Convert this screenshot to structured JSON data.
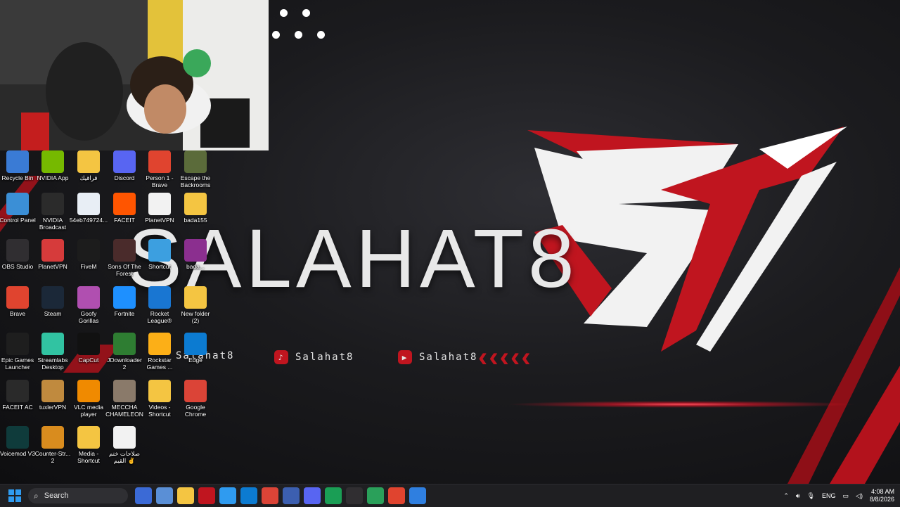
{
  "wallpaper": {
    "name": "SALAHAT8",
    "social_tiktok": "Salahat8",
    "social_youtube": "Salahat8",
    "social_kick": "Salahat8",
    "accent_color": "#c0151f"
  },
  "desktop_icons": [
    {
      "label": "Recycle Bin",
      "icon": "recycle-bin-icon",
      "color": "#3a7bd5"
    },
    {
      "label": "NVIDIA App",
      "icon": "nvidia-icon",
      "color": "#76b900"
    },
    {
      "label": "قراقيك",
      "icon": "folder-icon",
      "color": "#f4c542"
    },
    {
      "label": "Discord",
      "icon": "discord-icon",
      "color": "#5865f2"
    },
    {
      "label": "Person 1 -\nBrave",
      "icon": "brave-icon",
      "color": "#e0442f"
    },
    {
      "label": "Escape the\nBackrooms",
      "icon": "game-icon",
      "color": "#5b6b3a"
    },
    {
      "label": "Control Panel",
      "icon": "control-panel-icon",
      "color": "#3b8fd6"
    },
    {
      "label": "NVIDIA\nBroadcast",
      "icon": "nvidia-broadcast-icon",
      "color": "#2b2b2b"
    },
    {
      "label": "54eb749724...",
      "icon": "file-icon",
      "color": "#e8eef5"
    },
    {
      "label": "FACEIT",
      "icon": "faceit-icon",
      "color": "#ff5500"
    },
    {
      "label": "PlanetVPN",
      "icon": "document-icon",
      "color": "#f2f2f2"
    },
    {
      "label": "bada155",
      "icon": "folder-icon",
      "color": "#f4c542"
    },
    {
      "label": "OBS Studio",
      "icon": "obs-icon",
      "color": "#302e31"
    },
    {
      "label": "PlanetVPN",
      "icon": "planetvpn-icon",
      "color": "#d63b3b"
    },
    {
      "label": "FiveM",
      "icon": "fivem-icon",
      "color": "#1c1c1c"
    },
    {
      "label": "Sons Of The\nForest",
      "icon": "game-icon",
      "color": "#4a2b2b"
    },
    {
      "label": "Shortcut",
      "icon": "shortcut-icon",
      "color": "#3c9fe0"
    },
    {
      "label": "bada...",
      "icon": "winrar-icon",
      "color": "#8b2f8f"
    },
    {
      "label": "Brave",
      "icon": "brave-icon",
      "color": "#e0442f"
    },
    {
      "label": "Steam",
      "icon": "steam-icon",
      "color": "#1b2838"
    },
    {
      "label": "Goofy\nGorillas",
      "icon": "game-icon",
      "color": "#b04fb0"
    },
    {
      "label": "Fortnite",
      "icon": "fortnite-icon",
      "color": "#1e90ff"
    },
    {
      "label": "Rocket\nLeague®",
      "icon": "rocket-league-icon",
      "color": "#1976d2"
    },
    {
      "label": "New folder\n(2)",
      "icon": "folder-icon",
      "color": "#f4c542"
    },
    {
      "label": "Epic Games\nLauncher",
      "icon": "epic-games-icon",
      "color": "#1e1e1e"
    },
    {
      "label": "Streamlabs\nDesktop",
      "icon": "streamlabs-icon",
      "color": "#31c3a2"
    },
    {
      "label": "CapCut",
      "icon": "capcut-icon",
      "color": "#111111"
    },
    {
      "label": "JDownloader\n2",
      "icon": "jdownloader-icon",
      "color": "#2e7d32"
    },
    {
      "label": "Rockstar\nGames ...",
      "icon": "rockstar-icon",
      "color": "#fcaf17"
    },
    {
      "label": "Edge",
      "icon": "edge-icon",
      "color": "#0c7bd1"
    },
    {
      "label": "FACEIT AC",
      "icon": "faceit-ac-icon",
      "color": "#2a2a2a"
    },
    {
      "label": "tuxlerVPN",
      "icon": "tuxler-icon",
      "color": "#c08a3e"
    },
    {
      "label": "VLC media\nplayer",
      "icon": "vlc-icon",
      "color": "#f08a00"
    },
    {
      "label": "MECCHA\nCHAMELEON",
      "icon": "game-icon",
      "color": "#8a7a6a"
    },
    {
      "label": "Videos -\nShortcut",
      "icon": "folder-icon",
      "color": "#f4c542"
    },
    {
      "label": "Google\nChrome",
      "icon": "chrome-icon",
      "color": "#db4437"
    },
    {
      "label": "Voicemod V3",
      "icon": "voicemod-icon",
      "color": "#0f3b3b"
    },
    {
      "label": "Counter-Str...\n2",
      "icon": "cs2-icon",
      "color": "#d98c1e"
    },
    {
      "label": "Media -\nShortcut",
      "icon": "folder-icon",
      "color": "#f4c542"
    },
    {
      "label": "صلاحات ختم\nالقيم ✌",
      "icon": "document-icon",
      "color": "#f2f2f2"
    }
  ],
  "taskbar": {
    "search_placeholder": "Search",
    "apps": [
      {
        "name": "taskview-icon",
        "color": "#3b6ad6"
      },
      {
        "name": "widgets-icon",
        "color": "#5a8fd6"
      },
      {
        "name": "file-explorer-icon",
        "color": "#f4c542"
      },
      {
        "name": "recorder-icon",
        "color": "#c0151f"
      },
      {
        "name": "store-icon",
        "color": "#2f9bf0"
      },
      {
        "name": "edge-icon",
        "color": "#0c7bd1"
      },
      {
        "name": "chrome-icon",
        "color": "#db4437"
      },
      {
        "name": "app-icon",
        "color": "#3c5fb0"
      },
      {
        "name": "discord-icon",
        "color": "#5865f2"
      },
      {
        "name": "chrome-icon",
        "color": "#1a9e55"
      },
      {
        "name": "obs-icon",
        "color": "#302e31"
      },
      {
        "name": "xbox-icon",
        "color": "#2aa05a"
      },
      {
        "name": "brave-icon",
        "color": "#e0442f"
      },
      {
        "name": "defender-icon",
        "color": "#2f7fe0"
      }
    ],
    "language": "ENG",
    "time": "4:08 AM",
    "date": "8/8/2026"
  }
}
